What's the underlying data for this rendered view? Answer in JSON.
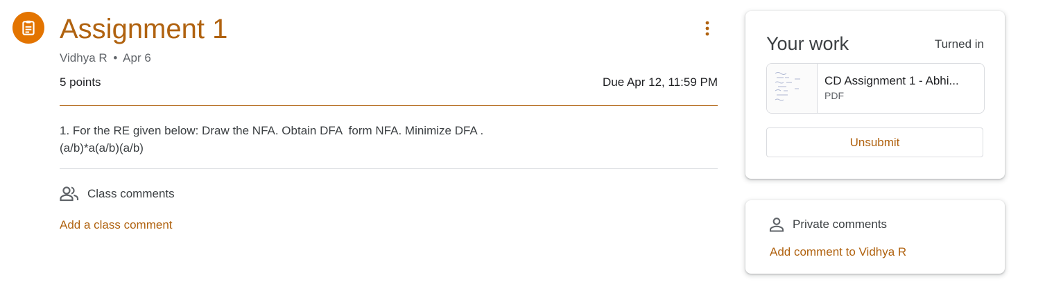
{
  "assignment": {
    "icon": "assignment-icon",
    "title": "Assignment 1",
    "author": "Vidhya R",
    "separator": "•",
    "posted_date": "Apr 6",
    "points": "5 points",
    "due": "Due Apr 12, 11:59 PM",
    "description": "1. For the RE given below: Draw the NFA. Obtain DFA  form NFA. Minimize DFA .\n(a/b)*a(a/b)(a/b)",
    "more_icon": "more-vert-icon"
  },
  "class_comments": {
    "icon": "people-icon",
    "label": "Class comments",
    "add_label": "Add a class comment"
  },
  "your_work": {
    "title": "Your work",
    "status": "Turned in",
    "attachment": {
      "name": "CD Assignment 1 - Abhi...",
      "type": "PDF"
    },
    "unsubmit_label": "Unsubmit"
  },
  "private_comments": {
    "icon": "person-icon",
    "label": "Private comments",
    "add_label": "Add comment to Vidhya R"
  },
  "colors": {
    "accent": "#b0620f",
    "icon_bg": "#e37400",
    "divider": "#dadce0"
  }
}
